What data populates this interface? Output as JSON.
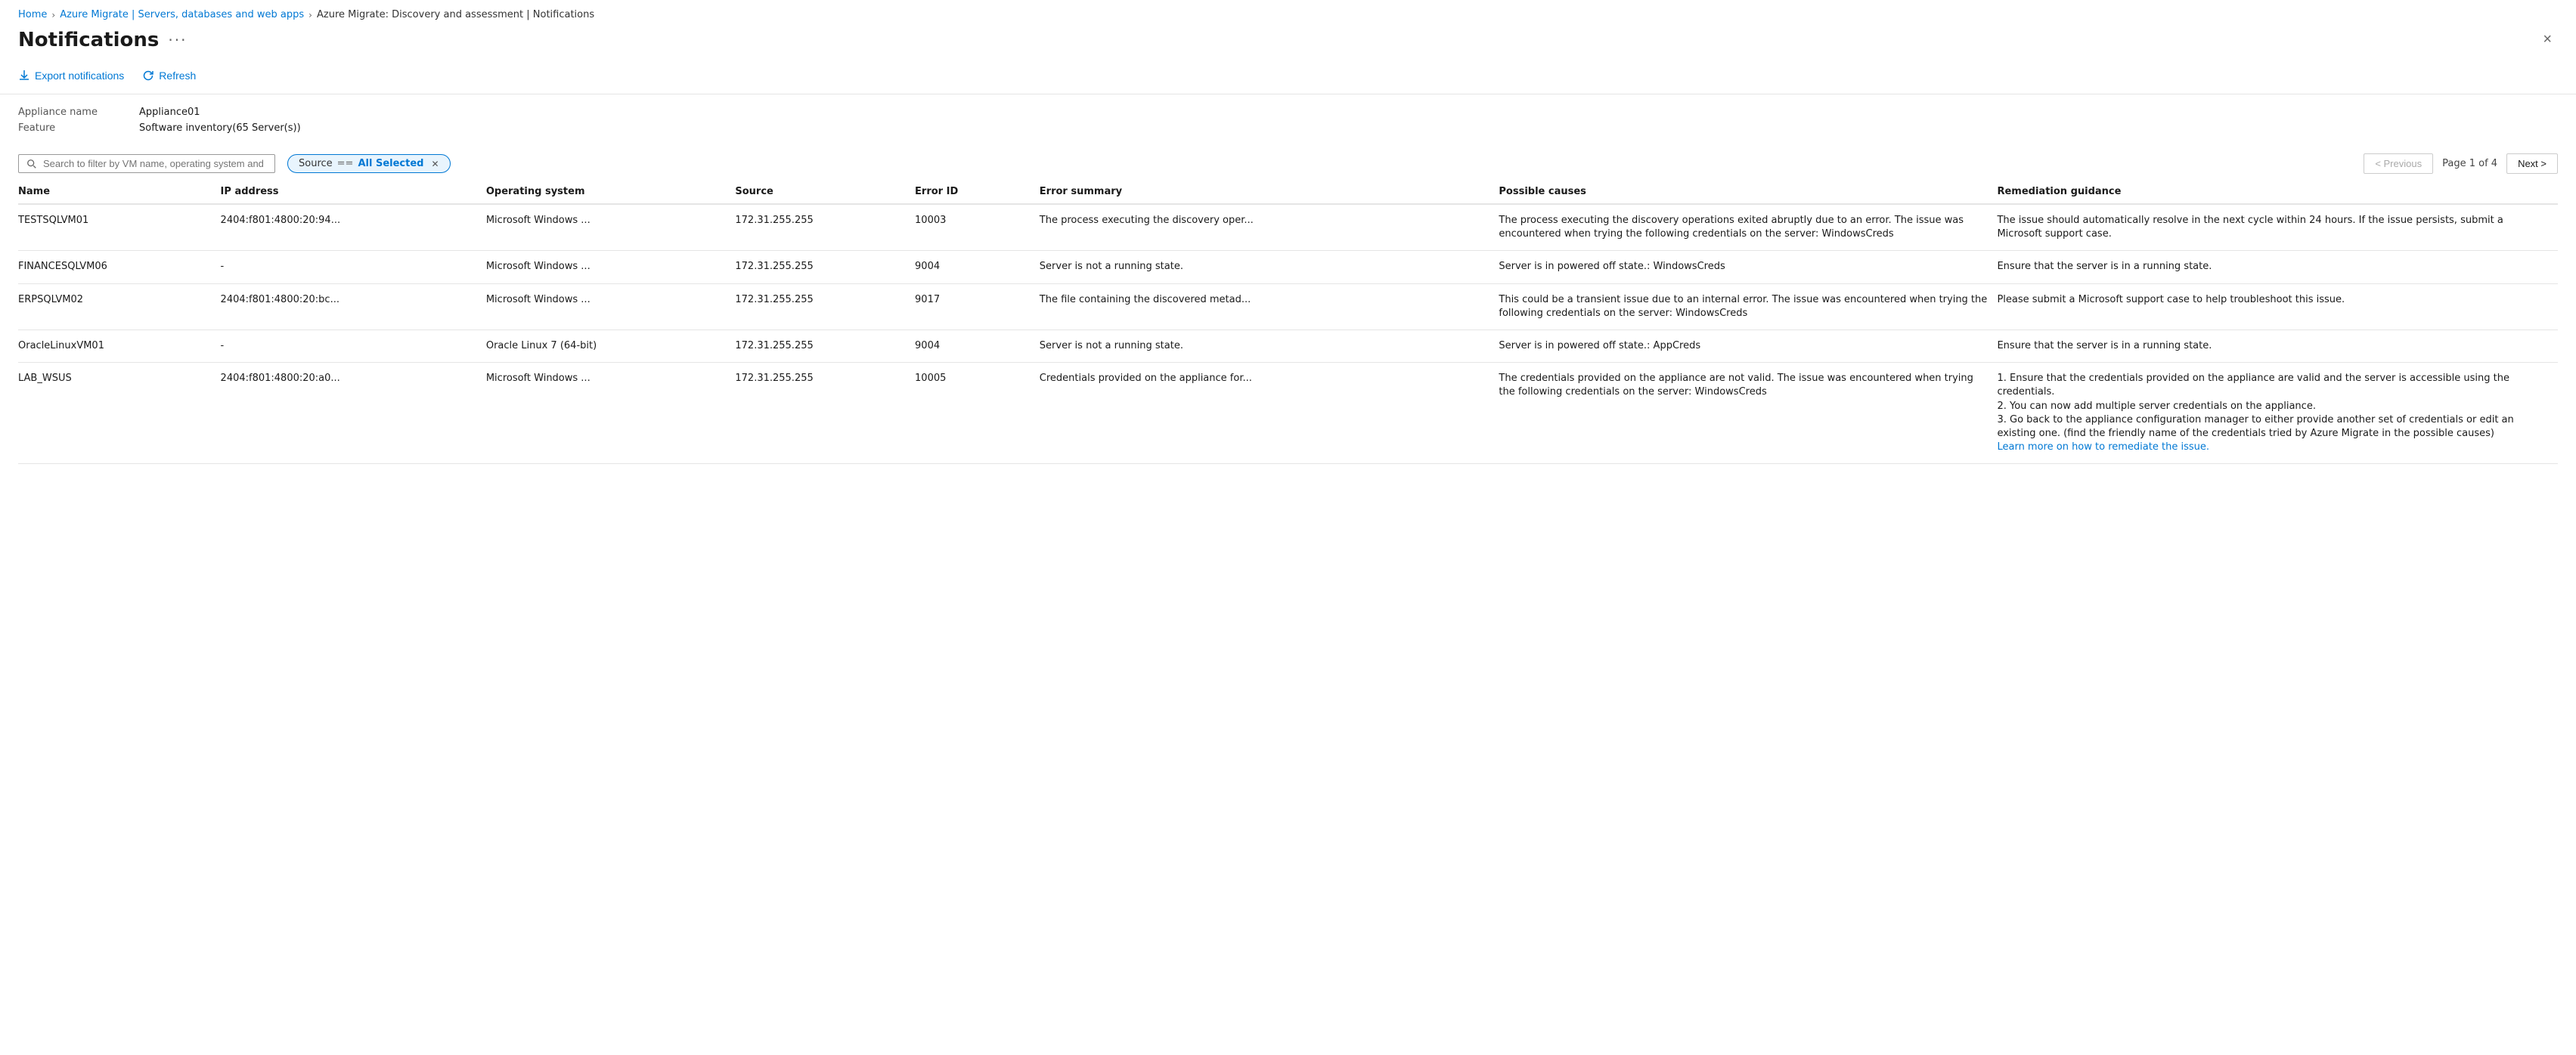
{
  "breadcrumb": {
    "items": [
      {
        "label": "Home",
        "active": true
      },
      {
        "label": "Azure Migrate | Servers, databases and web apps",
        "active": true
      },
      {
        "label": "Azure Migrate: Discovery and assessment | Notifications",
        "active": true
      }
    ]
  },
  "header": {
    "title": "Notifications",
    "more_label": "···"
  },
  "toolbar": {
    "export_label": "Export notifications",
    "refresh_label": "Refresh"
  },
  "metadata": {
    "appliance_label": "Appliance name",
    "appliance_value": "Appliance01",
    "feature_label": "Feature",
    "feature_value": "Software inventory(65 Server(s))"
  },
  "filter": {
    "search_placeholder": "Search to filter by VM name, operating system and error ID",
    "source_badge": {
      "prefix": "Source",
      "operator": "==",
      "value": "All Selected"
    }
  },
  "pagination": {
    "previous_label": "< Previous",
    "next_label": "Next >",
    "page_info": "Page 1 of 4"
  },
  "table": {
    "columns": [
      {
        "key": "name",
        "label": "Name"
      },
      {
        "key": "ip",
        "label": "IP address"
      },
      {
        "key": "os",
        "label": "Operating system"
      },
      {
        "key": "source",
        "label": "Source"
      },
      {
        "key": "error_id",
        "label": "Error ID"
      },
      {
        "key": "error_summary",
        "label": "Error summary"
      },
      {
        "key": "causes",
        "label": "Possible causes"
      },
      {
        "key": "remediation",
        "label": "Remediation guidance"
      }
    ],
    "rows": [
      {
        "name": "TESTSQLVM01",
        "ip": "2404:f801:4800:20:94...",
        "os": "Microsoft Windows ...",
        "source": "172.31.255.255",
        "error_id": "10003",
        "error_summary": "The process executing the discovery oper...",
        "causes": "The process executing the discovery operations exited abruptly due to an error. The issue was encountered when trying the following credentials on the server: WindowsCreds",
        "remediation": "The issue should automatically resolve in the next cycle within 24 hours. If the issue persists, submit a Microsoft support case.",
        "learn_more": null
      },
      {
        "name": "FINANCESQLVM06",
        "ip": "-",
        "os": "Microsoft Windows ...",
        "source": "172.31.255.255",
        "error_id": "9004",
        "error_summary": "Server is not a running state.",
        "causes": "Server is in powered off state.: WindowsCreds",
        "remediation": "Ensure that the server is in a running state.",
        "learn_more": null
      },
      {
        "name": "ERPSQLVM02",
        "ip": "2404:f801:4800:20:bc...",
        "os": "Microsoft Windows ...",
        "source": "172.31.255.255",
        "error_id": "9017",
        "error_summary": "The file containing the discovered metad...",
        "causes": "This could be a transient issue due to an internal error. The issue was encountered when trying the following credentials on the server: WindowsCreds",
        "remediation": "Please submit a Microsoft support case to help troubleshoot this issue.",
        "learn_more": null
      },
      {
        "name": "OracleLinuxVM01",
        "ip": "-",
        "os": "Oracle Linux 7 (64-bit)",
        "source": "172.31.255.255",
        "error_id": "9004",
        "error_summary": "Server is not a running state.",
        "causes": "Server is in powered off state.: AppCreds",
        "remediation": "Ensure that the server is in a running state.",
        "learn_more": null
      },
      {
        "name": "LAB_WSUS",
        "ip": "2404:f801:4800:20:a0...",
        "os": "Microsoft Windows ...",
        "source": "172.31.255.255",
        "error_id": "10005",
        "error_summary": "Credentials provided on the appliance for...",
        "causes": "The credentials provided on the appliance are not valid. The issue was encountered when trying the following credentials on the server: WindowsCreds",
        "remediation": "1. Ensure that the credentials provided on the appliance are valid and the server is accessible using the credentials.\n2. You can now add multiple server credentials on the appliance.\n3. Go back to the appliance configuration manager to either provide another set of credentials or edit an existing one. (find the friendly name of the credentials tried by Azure Migrate in the possible causes)",
        "learn_more": "Learn more on how to remediate the issue."
      }
    ]
  },
  "close_label": "×"
}
